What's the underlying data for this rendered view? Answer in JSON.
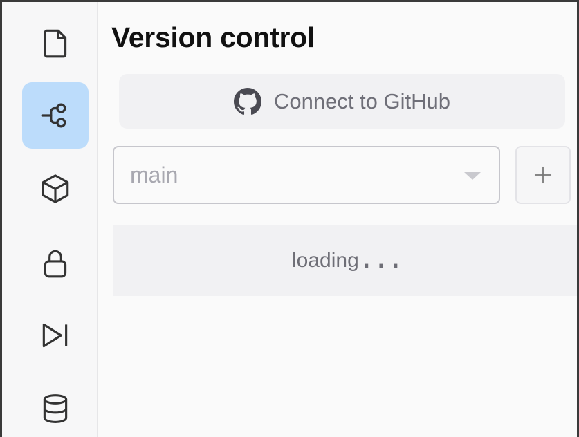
{
  "activity_bar": {
    "items": [
      {
        "icon": "file-icon",
        "active": false
      },
      {
        "icon": "git-branch-icon",
        "active": true
      },
      {
        "icon": "package-cube-icon",
        "active": false
      },
      {
        "icon": "lock-icon",
        "active": false
      },
      {
        "icon": "run-deploy-icon",
        "active": false
      },
      {
        "icon": "database-icon",
        "active": false
      }
    ],
    "active_color": "#bcdcfb"
  },
  "panel": {
    "title": "Version control",
    "github_button": {
      "icon": "github-icon",
      "label": "Connect to GitHub"
    },
    "branch_select": {
      "value": "main"
    },
    "add_branch_button": {
      "icon": "plus-icon"
    },
    "status": {
      "text": "loading",
      "dots": "..."
    }
  }
}
